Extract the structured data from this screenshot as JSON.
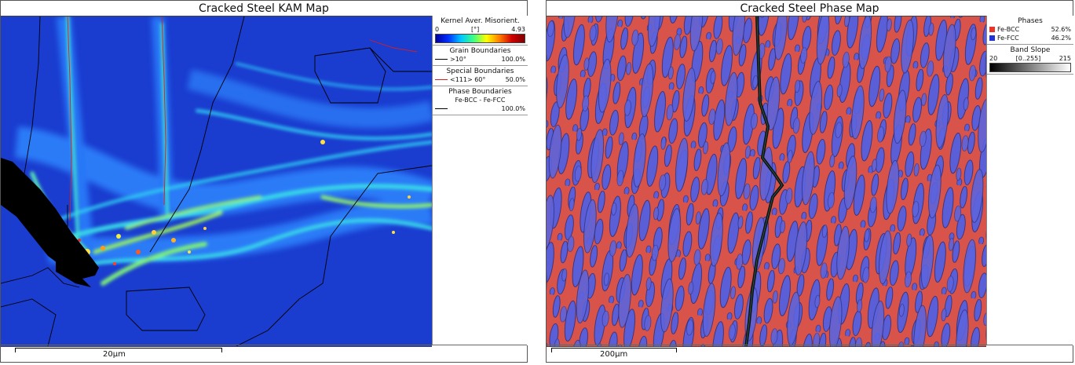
{
  "left_panel": {
    "title": "Cracked Steel KAM Map",
    "legend": {
      "kam_title": "Kernel Aver. Misorient.",
      "kam_min": "0",
      "kam_unit": "[°]",
      "kam_max": "4.93",
      "grain_title": "Grain Boundaries",
      "grain_label": ">10°",
      "grain_value": "100.0%",
      "special_title": "Special Boundaries",
      "special_label": "<111> 60°",
      "special_value": "50.0%",
      "phase_title": "Phase Boundaries",
      "phase_label": "Fe-BCC - Fe-FCC",
      "phase_value": "100.0%"
    },
    "scale_label": "20µm"
  },
  "right_panel": {
    "title": "Cracked Steel Phase Map",
    "legend": {
      "phases_title": "Phases",
      "phases": [
        {
          "name": "Fe-BCC",
          "value": "52.6%",
          "color": "#e8352b"
        },
        {
          "name": "Fe-FCC",
          "value": "46.2%",
          "color": "#2233d6"
        }
      ],
      "band_title": "Band Slope",
      "band_min": "20",
      "band_range": "[0..255]",
      "band_max": "215"
    },
    "scale_label": "200µm"
  },
  "colors": {
    "kam_background": "#1f3fc8",
    "bcc_red": "#d9544a",
    "fcc_blue": "#5b61d6",
    "special_boundary": "#d62020"
  }
}
